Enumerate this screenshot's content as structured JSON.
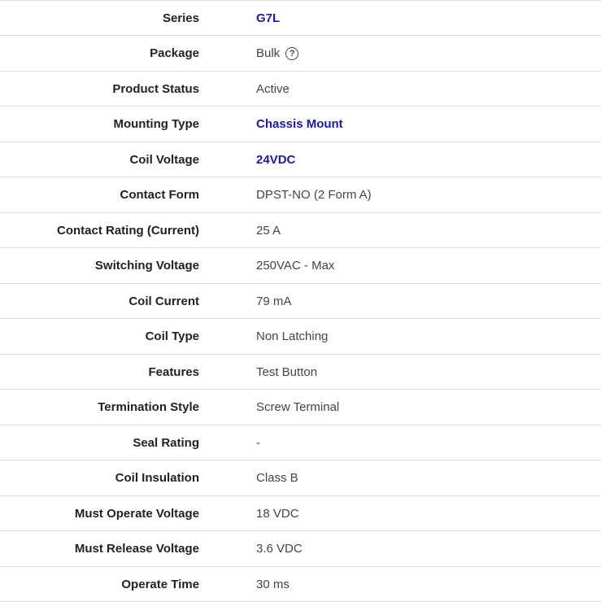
{
  "specs": [
    {
      "label": "Series",
      "value": "G7L",
      "link": true
    },
    {
      "label": "Package",
      "value": "Bulk",
      "link": false,
      "help_icon": "question-circle-icon"
    },
    {
      "label": "Product Status",
      "value": "Active",
      "link": false
    },
    {
      "label": "Mounting Type",
      "value": "Chassis Mount",
      "link": true
    },
    {
      "label": "Coil Voltage",
      "value": "24VDC",
      "link": true
    },
    {
      "label": "Contact Form",
      "value": "DPST-NO (2 Form A)",
      "link": false
    },
    {
      "label": "Contact Rating (Current)",
      "value": "25 A",
      "link": false
    },
    {
      "label": "Switching Voltage",
      "value": "250VAC - Max",
      "link": false
    },
    {
      "label": "Coil Current",
      "value": "79 mA",
      "link": false
    },
    {
      "label": "Coil Type",
      "value": "Non Latching",
      "link": false
    },
    {
      "label": "Features",
      "value": "Test Button",
      "link": false
    },
    {
      "label": "Termination Style",
      "value": "Screw Terminal",
      "link": false
    },
    {
      "label": "Seal Rating",
      "value": "-",
      "link": false
    },
    {
      "label": "Coil Insulation",
      "value": "Class B",
      "link": false
    },
    {
      "label": "Must Operate Voltage",
      "value": "18 VDC",
      "link": false
    },
    {
      "label": "Must Release Voltage",
      "value": "3.6 VDC",
      "link": false
    },
    {
      "label": "Operate Time",
      "value": "30 ms",
      "link": false
    }
  ],
  "colors": {
    "link": "#1a1aa6",
    "label": "#222222",
    "value": "#444444",
    "divider": "#dcdcdc"
  }
}
